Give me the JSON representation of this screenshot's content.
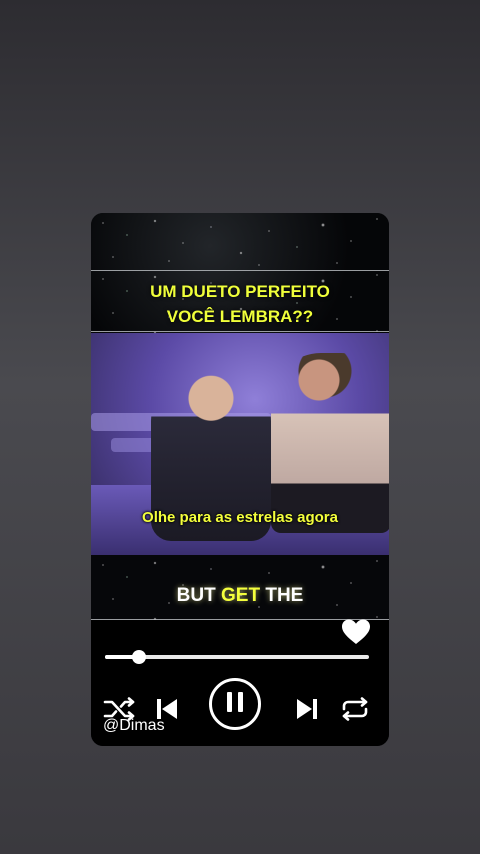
{
  "post": {
    "caption_line1": "UM DUETO PERFEITO",
    "caption_line2": "VOCÊ LEMBRA??",
    "video_subtitle": "Olhe para as estrelas agora",
    "lyric_word1": "BUT",
    "lyric_word2": "GET",
    "lyric_word3": "THE",
    "watermark": "@Dimas"
  },
  "player": {
    "progress_fraction": 0.13,
    "liked": true,
    "is_playing": true
  },
  "icons": {
    "like": "heart-icon",
    "shuffle": "shuffle-icon",
    "previous": "skip-previous-icon",
    "pause": "pause-icon",
    "next": "skip-next-icon",
    "repeat": "repeat-icon"
  },
  "colors": {
    "caption": "#f0ff3a",
    "background_top": "#2d2c31",
    "player_bg": "#000000"
  }
}
